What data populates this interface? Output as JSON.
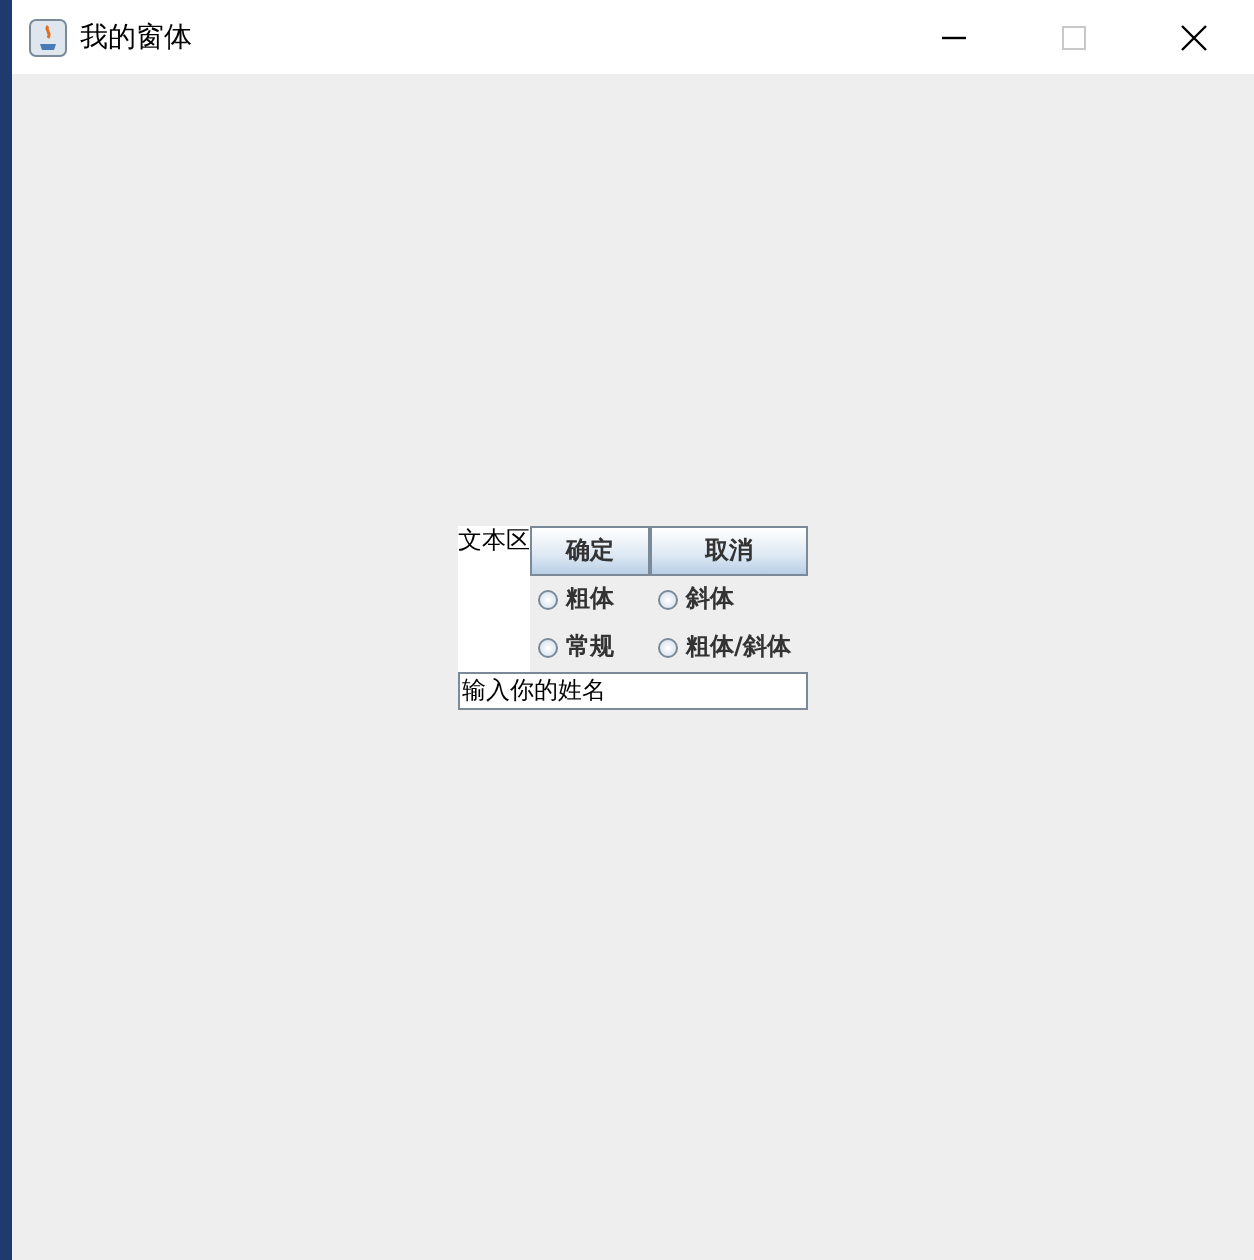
{
  "window": {
    "title": "我的窗体",
    "maximize_disabled": true
  },
  "text_area": {
    "value": "文本区"
  },
  "buttons": [
    "确定",
    "取消"
  ],
  "radios": [
    {
      "label": "粗体",
      "selected": false
    },
    {
      "label": "斜体",
      "selected": false
    },
    {
      "label": "常规",
      "selected": false
    },
    {
      "label": "粗体/斜体",
      "selected": false
    }
  ],
  "name_field": {
    "value": "输入你的姓名"
  }
}
